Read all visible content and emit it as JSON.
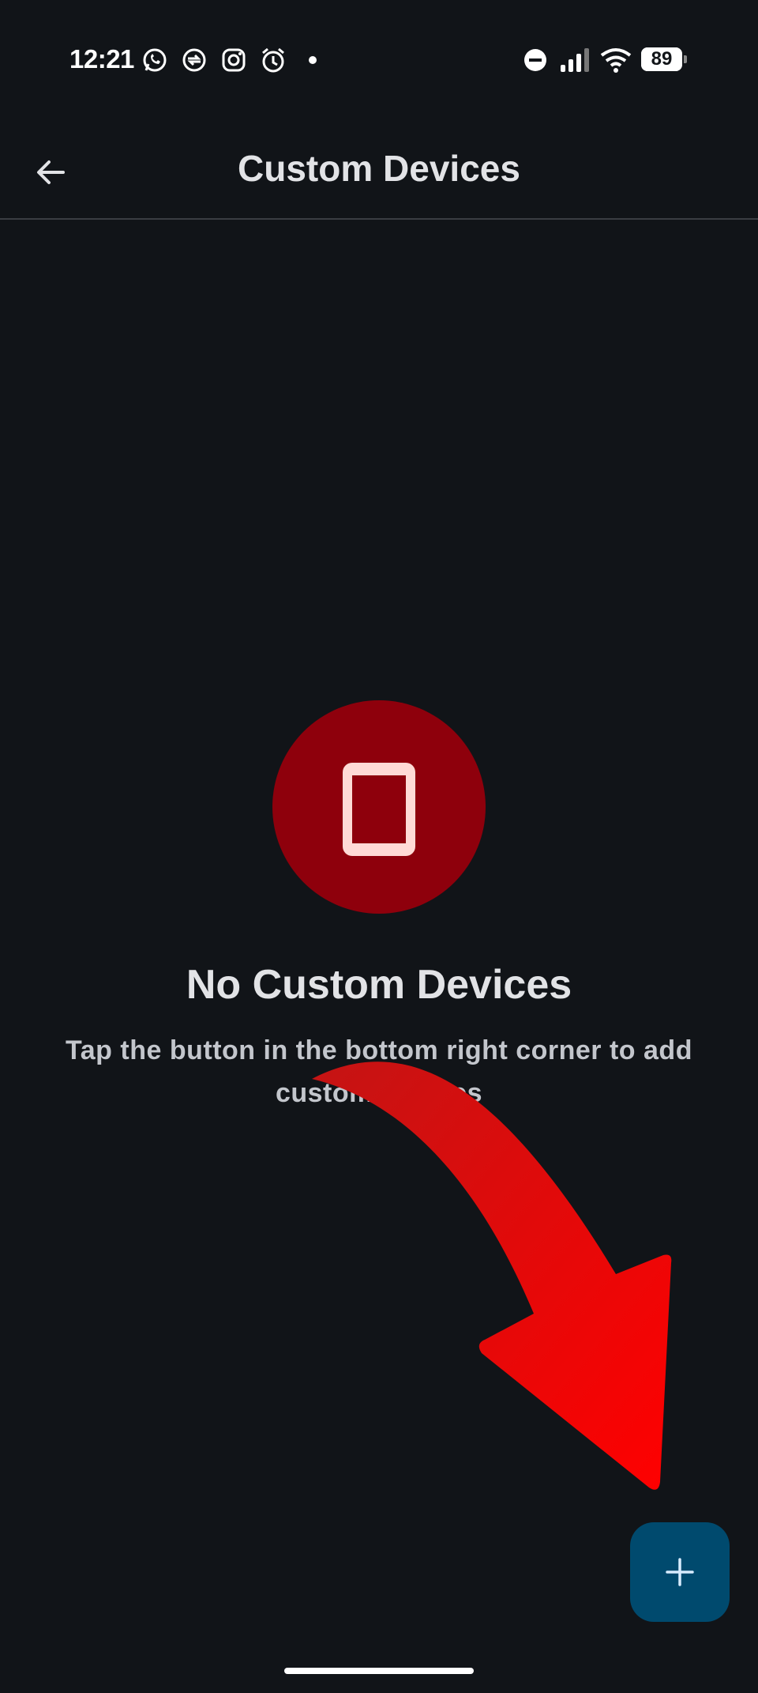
{
  "status_bar": {
    "time": "12:21",
    "battery_percent": "89",
    "notification_icons": [
      "whatsapp-icon",
      "sync-icon",
      "instagram-icon",
      "alarm-icon",
      "dot-icon"
    ],
    "system_icons": [
      "do-not-disturb-icon",
      "signal-icon",
      "wifi-icon",
      "battery-icon"
    ]
  },
  "app_bar": {
    "title": "Custom Devices",
    "back_icon": "arrow-back-icon"
  },
  "empty_state": {
    "icon": "smartphone-icon",
    "title": "No Custom Devices",
    "subtitle": "Tap the button in the bottom right corner to add custom devices"
  },
  "fab": {
    "icon": "plus-icon"
  },
  "annotation": {
    "icon": "red-curved-arrow",
    "color": "#e30000"
  },
  "colors": {
    "background": "#111418",
    "icon_circle": "#8e000c",
    "icon_fg": "#ffdad6",
    "fab_bg": "#004a6e"
  }
}
